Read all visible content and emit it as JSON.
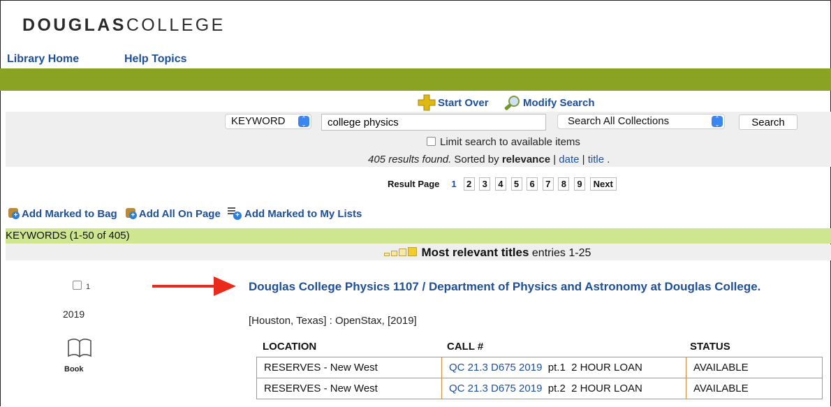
{
  "header": {
    "logo_bold": "DOUGLAS",
    "logo_light": "COLLEGE",
    "nav": [
      {
        "label": "Library Home"
      },
      {
        "label": "Help Topics"
      }
    ]
  },
  "search_tools": {
    "start_over": "Start Over",
    "modify_search": "Modify Search",
    "search_type": "KEYWORD",
    "query": "college physics",
    "collection": "Search All Collections",
    "search_button": "Search",
    "limit_label": "Limit search to available items"
  },
  "results_info": {
    "count_text": "405 results found.",
    "sorted_by": "Sorted by",
    "sort_current": "relevance",
    "sep": "|",
    "sort_date": "date",
    "sort_title": "title",
    "end": "."
  },
  "pagination": {
    "label": "Result Page",
    "pages": [
      "1",
      "2",
      "3",
      "4",
      "5",
      "6",
      "7",
      "8",
      "9"
    ],
    "next": "Next"
  },
  "actions": {
    "add_marked_to_bag": "Add Marked to Bag",
    "add_all_on_page": "Add All On Page",
    "add_marked_to_lists": "Add Marked to My Lists"
  },
  "keywords_bar": "KEYWORDS (1-50 of 405)",
  "relevance_bar": {
    "bold": "Most relevant titles",
    "rest": "entries 1-25"
  },
  "result": {
    "number": "1",
    "year": "2019",
    "format": "Book",
    "title": "Douglas College Physics 1107 / Department of Physics and Astronomy at Douglas College.",
    "publisher": "[Houston, Texas] : OpenStax, [2019]",
    "holdings_headers": {
      "location": "LOCATION",
      "call": "CALL #",
      "status": "STATUS"
    },
    "holdings": [
      {
        "location": "RESERVES - New West",
        "call": "QC 21.3 D675 2019",
        "call_suffix": "pt.1  2 HOUR LOAN",
        "status": "AVAILABLE"
      },
      {
        "location": "RESERVES - New West",
        "call": "QC 21.3 D675 2019",
        "call_suffix": "pt.2  2 HOUR LOAN",
        "status": "AVAILABLE"
      }
    ]
  },
  "colors": {
    "green_bar": "#8aa323",
    "keywords_bar": "#cfe691",
    "link": "#1d4f9a",
    "arrow": "#ea2a1b",
    "table_border": "#e0873a"
  }
}
